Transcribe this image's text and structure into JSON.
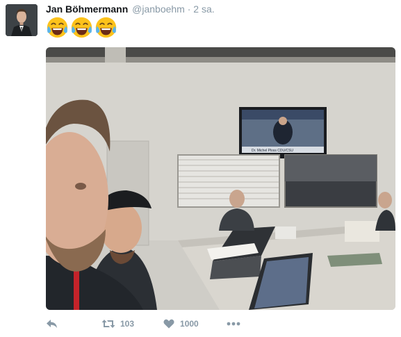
{
  "tweet": {
    "author_name": "Jan Böhmermann",
    "author_handle": "@janboehm",
    "separator": "·",
    "timestamp": "2 sa.",
    "emojis": [
      "face-with-tears-of-joy",
      "face-with-tears-of-joy",
      "face-with-tears-of-joy"
    ],
    "photo_tv_caption": "Dr. Michel Ploss CDU/CSU"
  },
  "actions": {
    "reply_icon": "reply-icon",
    "retweet_icon": "retweet-icon",
    "retweet_count": "103",
    "like_icon": "heart-icon",
    "like_count": "1000",
    "more_icon": "more-icon"
  },
  "colors": {
    "name": "#14171a",
    "meta": "#8899a6",
    "emoji_face": "#fcc21b"
  }
}
